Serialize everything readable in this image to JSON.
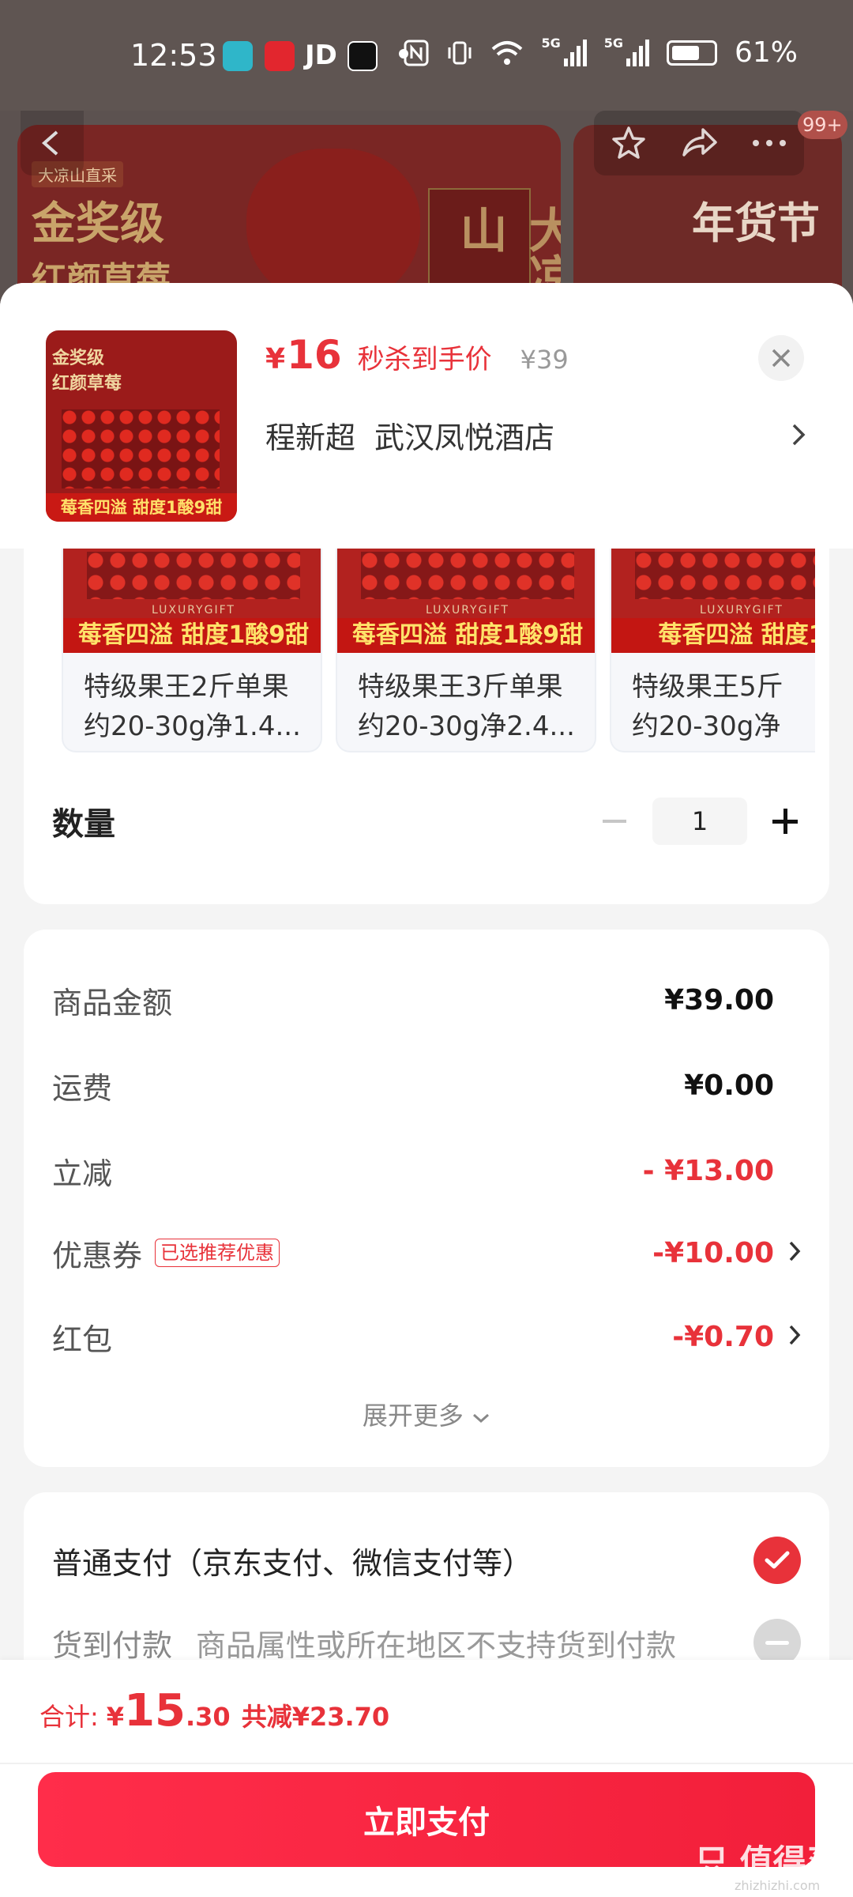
{
  "status_bar": {
    "time": "12:53",
    "jd": "JD",
    "battery": "61%",
    "network": "5G"
  },
  "banner": {
    "tag": "大凉山直采",
    "title1": "金奖级",
    "title2": "红颜草莓",
    "box_text": "大凉山",
    "festival": "年货节",
    "cart_badge": "99+"
  },
  "product": {
    "thumb_title1": "金奖级",
    "thumb_title2": "红颜草莓",
    "thumb_strip": "莓香四溢 甜度1酸9甜",
    "price_symbol": "¥",
    "price": "16",
    "price_label": "秒杀到手价",
    "original_price": "¥39",
    "address_name": "程新超",
    "address": "武汉凤悦酒店"
  },
  "variants": [
    {
      "strip": "莓香四溢 甜度1酸9甜",
      "line1": "特级果王2斤单果",
      "line2": "约20-30g净1.4..."
    },
    {
      "strip": "莓香四溢 甜度1酸9甜",
      "line1": "特级果王3斤单果",
      "line2": "约20-30g净2.4..."
    },
    {
      "strip": "莓香四溢 甜度1",
      "line1": "特级果王5斤",
      "line2": "约20-30g净"
    }
  ],
  "variant_lux": "LUXURYGIFT",
  "quantity": {
    "label": "数量",
    "value": "1"
  },
  "summary": {
    "goods_label": "商品金额",
    "goods_value": "¥39.00",
    "shipping_label": "运费",
    "shipping_value": "¥0.00",
    "discount_label": "立减",
    "discount_value": "- ¥13.00",
    "coupon_label": "优惠券",
    "coupon_tag": "已选推荐优惠",
    "coupon_value": "-¥10.00",
    "redpacket_label": "红包",
    "redpacket_value": "-¥0.70",
    "expand": "展开更多"
  },
  "payment": {
    "normal": "普通支付（京东支付、微信支付等）",
    "cod": "货到付款",
    "cod_note": "商品属性或所在地区不支持货到付款"
  },
  "bottom": {
    "total_label": "合计:",
    "total_yen": "¥",
    "total_int": "15",
    "total_dec": ".30",
    "total_saving": "共减¥23.70",
    "pay_button": "立即支付",
    "watermark": "只 值得买",
    "watermark_sub": "zhizhizhi.com"
  },
  "colors": {
    "accent": "#e8323a",
    "button": "#f21f3a"
  }
}
